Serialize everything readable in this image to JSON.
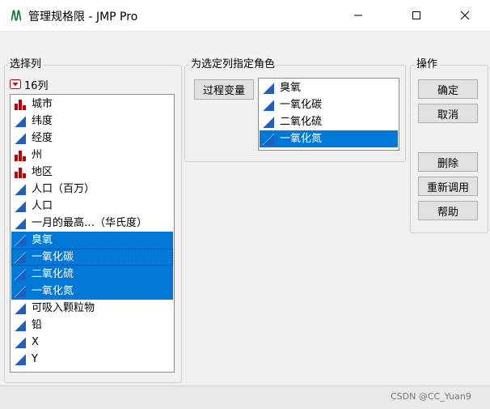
{
  "window": {
    "title": "管理规格限 - JMP Pro",
    "colors": {
      "accent": "#0078d7",
      "continuous": "#1f5fbf",
      "nominal": "#c00000"
    }
  },
  "select_columns": {
    "label": "选择列",
    "count_label": "16列",
    "items": [
      {
        "label": "城市",
        "icon": "nominal-bar-icon",
        "selected": false
      },
      {
        "label": "纬度",
        "icon": "continuous-triangle-icon",
        "selected": false
      },
      {
        "label": "经度",
        "icon": "continuous-triangle-icon",
        "selected": false
      },
      {
        "label": "州",
        "icon": "nominal-bar-icon",
        "selected": false
      },
      {
        "label": "地区",
        "icon": "nominal-bar-icon",
        "selected": false
      },
      {
        "label": "人口（百万）",
        "icon": "continuous-triangle-icon",
        "selected": false
      },
      {
        "label": "人口",
        "icon": "continuous-triangle-icon",
        "selected": false
      },
      {
        "label": "一月的最高…（华氏度）",
        "icon": "continuous-triangle-icon",
        "selected": false
      },
      {
        "label": "臭氧",
        "icon": "continuous-triangle-icon",
        "selected": true
      },
      {
        "label": "一氧化碳",
        "icon": "continuous-triangle-icon",
        "selected": true
      },
      {
        "label": "二氧化硫",
        "icon": "continuous-triangle-icon",
        "selected": true
      },
      {
        "label": "一氧化氮",
        "icon": "continuous-triangle-icon",
        "selected": true
      },
      {
        "label": "可吸入颗粒物",
        "icon": "continuous-triangle-icon",
        "selected": false
      },
      {
        "label": "铅",
        "icon": "continuous-triangle-icon",
        "selected": false
      },
      {
        "label": "X",
        "icon": "continuous-triangle-icon",
        "selected": false
      },
      {
        "label": "Y",
        "icon": "continuous-triangle-icon",
        "selected": false
      }
    ]
  },
  "assign_roles": {
    "label": "为选定列指定角色",
    "role_button": "过程变量",
    "items": [
      {
        "label": "臭氧",
        "selected": false
      },
      {
        "label": "一氧化碳",
        "selected": false
      },
      {
        "label": "二氧化硫",
        "selected": false
      },
      {
        "label": "一氧化氮",
        "selected": true
      }
    ]
  },
  "actions": {
    "label": "操作",
    "ok": "确定",
    "cancel": "取消",
    "remove": "删除",
    "recall": "重新调用",
    "help": "帮助"
  },
  "watermark": "CSDN @CC_Yuan9"
}
